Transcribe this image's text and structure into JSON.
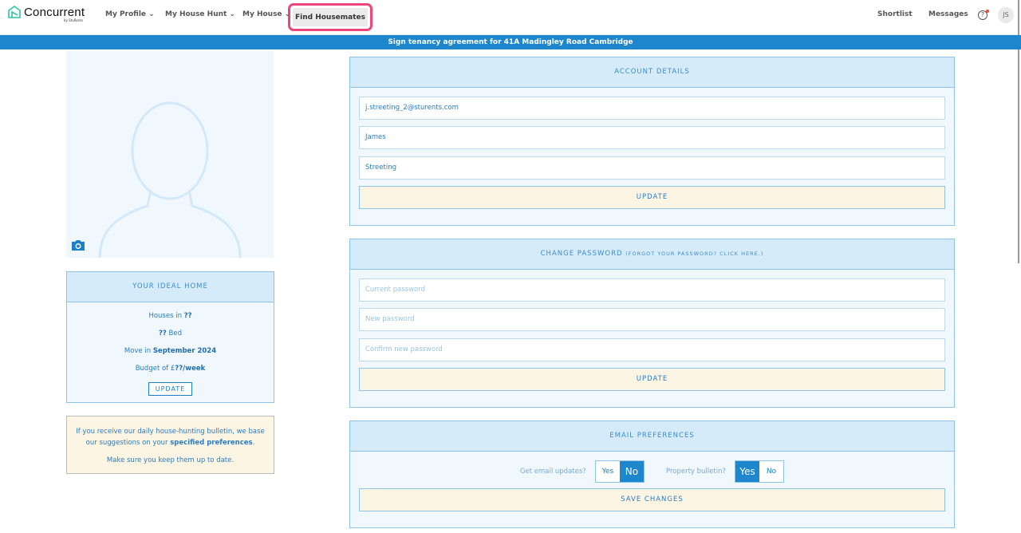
{
  "nav": {
    "logo": "Concurrent",
    "logo_sub": "by StuRents",
    "items": [
      "My Profile",
      "My House Hunt",
      "My House"
    ],
    "find": "Find Housemates",
    "shortlist": "Shortlist",
    "messages": "Messages",
    "help": "?",
    "avatar": "JS"
  },
  "banner": "Sign tenancy agreement for 41A Madingley Road Cambridge",
  "ideal": {
    "title": "YOUR IDEAL HOME",
    "houses_in": "Houses in ",
    "houses_val": "??",
    "bed_val": "??",
    "bed": " Bed",
    "move_in": "Move in ",
    "move_val": "September 2024",
    "budget": "Budget of £",
    "budget_val": "??/week",
    "update": "UPDATE"
  },
  "note": {
    "line1a": "If you receive our daily house-hunting bulletin, we base our suggestions on your ",
    "line1b": "specified preferences",
    "line1c": ".",
    "line2": "Make sure you keep them up to date."
  },
  "account": {
    "title": "ACCOUNT DETAILS",
    "email": "j.streeting_2@sturents.com",
    "first": "James",
    "last": "Streeting",
    "update": "UPDATE"
  },
  "password": {
    "title": "CHANGE PASSWORD",
    "forgot": "(FORGOT YOUR PASSWORD? CLICK HERE.)",
    "current": "Current password",
    "new": "New password",
    "confirm": "Confirm new password",
    "update": "UPDATE"
  },
  "email": {
    "title": "EMAIL PREFERENCES",
    "updates_label": "Get email updates?",
    "bulletin_label": "Property bulletin?",
    "yes": "Yes",
    "no": "No",
    "updates_value": "No",
    "bulletin_value": "Yes",
    "save": "SAVE CHANGES"
  }
}
